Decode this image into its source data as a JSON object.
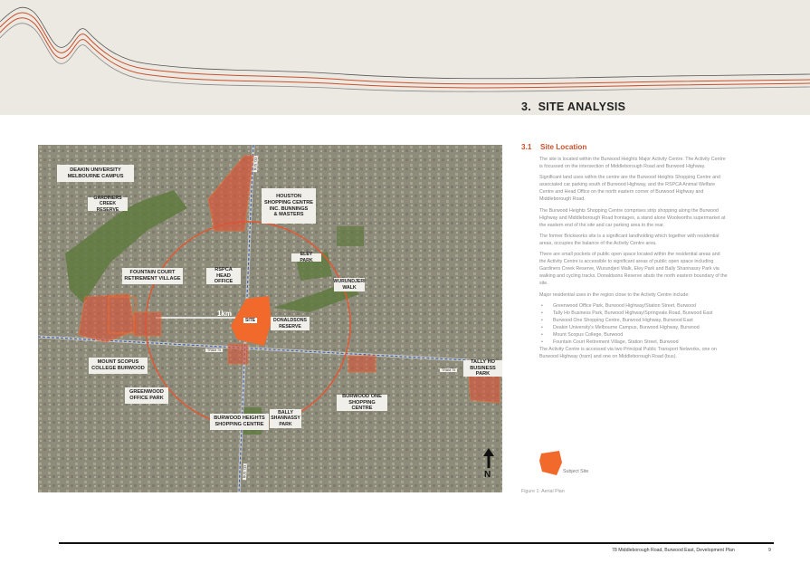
{
  "section": {
    "number": "3.",
    "title": "SITE ANALYSIS"
  },
  "subsection": {
    "number": "3.1",
    "title": "Site Location"
  },
  "colors": {
    "accent": "#c9512c",
    "site_orange": "#f26a2b",
    "band": "#ece9e3"
  },
  "paragraphs": [
    "The site is located within the Burwood Heights Major Activity Centre. The Activity Centre is focussed on the intersection of Middleborough Road and Burwood Highway.",
    "Significant land uses within the centre are the Burwood Heights Shopping Centre and associated car parking south of Burwood Highway, and the RSPCA Animal Welfare Centre and Head Office on the north eastern corner of Burwood Highway and Middleborough Road.",
    "The Burwood Heights Shopping Centre comprises strip shopping along the Burwood Highway and Middleborough Road frontages, a stand alone Woolworths supermarket at the eastern end of the site and car parking area to the rear.",
    "The former Brickworks site is a significant landholding which together with residential areas, occupies the balance of the Activity Centre area.",
    "There are small pockets of public open space located within the residential areas and the Activity Centre is accessible to significant areas of public open space including Gardiners Creek Reserve, Wurundjeri Walk, Eley Park and Bally Shannassy Park via walking and cycling tracks. Donaldsons Reserve abuts the north eastern boundary of the site.",
    "Major residential uses in the region close to the Activity Centre include:"
  ],
  "bullets": [
    "Greenwood Office Park, Burwood Highway/Station Street, Burwood",
    "Tally Ho Business Park, Burwood Highway/Springvale Road, Burwood East",
    "Burwood One Shopping Centre, Burwood Highway, Burwood East",
    "Deakin University's Melbourne Campus, Burwood Highway, Burwood",
    "Mount Scopus College, Burwood",
    "Fountain Court Retirement Village, Station Street, Burwood"
  ],
  "closing_paragraph": "The Activity Centre is accessed via two Principal Public Transport Networks, one on Burwood Highway (tram) and one on Middleborough Road (bus).",
  "legend_label": "Subject Site",
  "figure_caption": "Figure 1: Aerial Plan",
  "map": {
    "labels": {
      "deakin": "DEAKIN UNIVERSITY\nMELBOURNE CAMPUS",
      "gardiners": "GARDINERS\nCREEK RESERVE",
      "houston": "HOUSTON\nSHOPPING CENTRE\nINC. BUNNINGS\n& MASTERS",
      "fountain": "FOUNTAIN COURT\nRETIREMENT VILLAGE",
      "rspca": "RSPCA\nHEAD OFFICE",
      "eley": "ELEY PARK",
      "wurundjeri": "WURUNDJERI\nWALK",
      "donaldsons": "DONALDSONS\nRESERVE",
      "scopus": "MOUNT SCOPUS\nCOLLEGE BURWOOD",
      "greenwood": "GREENWOOD\nOFFICE PARK",
      "bally": "BALLY\nSHANNASSY\nPARK",
      "burwood_heights": "BURWOOD HEIGHTS\nSHOPPING CENTRE",
      "burwood_one": "BURWOOD ONE\nSHOPPING CENTRE",
      "tally_ho": "TALLY HO\nBUSINESS PARK"
    },
    "km_label": "1km",
    "site_label": "SITE",
    "north_label": "N",
    "roads": {
      "bus_north": "BUS 733",
      "tram_west": "TRAM 75",
      "tram_east": "TRAM 75",
      "bus_south": "BUS 733"
    }
  },
  "footer": {
    "text": "78 Middleborough Road, Burwood East, Development Plan",
    "page": "9"
  }
}
